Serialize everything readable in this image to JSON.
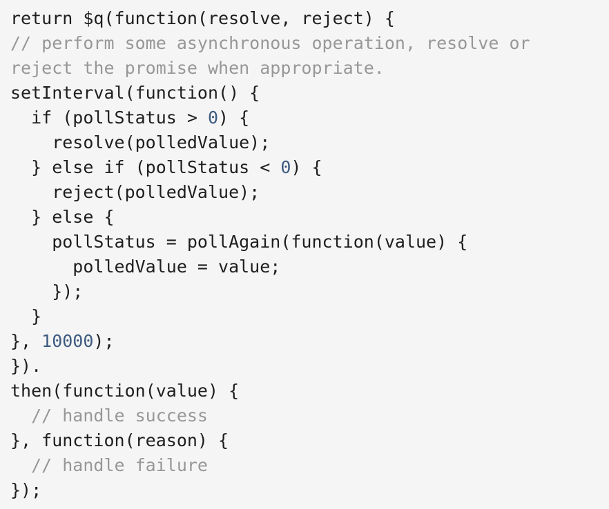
{
  "code": {
    "lines": [
      {
        "tokens": [
          {
            "text": "return $q(function(resolve, reject) {",
            "type": "plain"
          }
        ]
      },
      {
        "tokens": [
          {
            "text": "// perform some asynchronous operation, resolve or",
            "type": "comment"
          }
        ]
      },
      {
        "tokens": [
          {
            "text": "reject the promise when appropriate.",
            "type": "comment"
          }
        ]
      },
      {
        "tokens": [
          {
            "text": "setInterval(function() {",
            "type": "plain"
          }
        ]
      },
      {
        "tokens": [
          {
            "text": "  if (pollStatus > ",
            "type": "plain"
          },
          {
            "text": "0",
            "type": "number"
          },
          {
            "text": ") {",
            "type": "plain"
          }
        ]
      },
      {
        "tokens": [
          {
            "text": "    resolve(polledValue);",
            "type": "plain"
          }
        ]
      },
      {
        "tokens": [
          {
            "text": "  } else if (pollStatus < ",
            "type": "plain"
          },
          {
            "text": "0",
            "type": "number"
          },
          {
            "text": ") {",
            "type": "plain"
          }
        ]
      },
      {
        "tokens": [
          {
            "text": "    reject(polledValue);",
            "type": "plain"
          }
        ]
      },
      {
        "tokens": [
          {
            "text": "  } else {",
            "type": "plain"
          }
        ]
      },
      {
        "tokens": [
          {
            "text": "    pollStatus = pollAgain(function(value) {",
            "type": "plain"
          }
        ]
      },
      {
        "tokens": [
          {
            "text": "      polledValue = value;",
            "type": "plain"
          }
        ]
      },
      {
        "tokens": [
          {
            "text": "    });",
            "type": "plain"
          }
        ]
      },
      {
        "tokens": [
          {
            "text": "  }",
            "type": "plain"
          }
        ]
      },
      {
        "tokens": [
          {
            "text": "}, ",
            "type": "plain"
          },
          {
            "text": "10000",
            "type": "number"
          },
          {
            "text": ");",
            "type": "plain"
          }
        ]
      },
      {
        "tokens": [
          {
            "text": "}).",
            "type": "plain"
          }
        ]
      },
      {
        "tokens": [
          {
            "text": "then(function(value) {",
            "type": "plain"
          }
        ]
      },
      {
        "tokens": [
          {
            "text": "  // handle success",
            "type": "comment"
          }
        ]
      },
      {
        "tokens": [
          {
            "text": "}, function(reason) {",
            "type": "plain"
          }
        ]
      },
      {
        "tokens": [
          {
            "text": "  // handle failure",
            "type": "comment"
          }
        ]
      },
      {
        "tokens": [
          {
            "text": "});",
            "type": "plain"
          }
        ]
      }
    ]
  },
  "colors": {
    "background": "#f5f5f5",
    "text": "#1e1e1e",
    "comment": "#969896",
    "number": "#3d5a80"
  }
}
